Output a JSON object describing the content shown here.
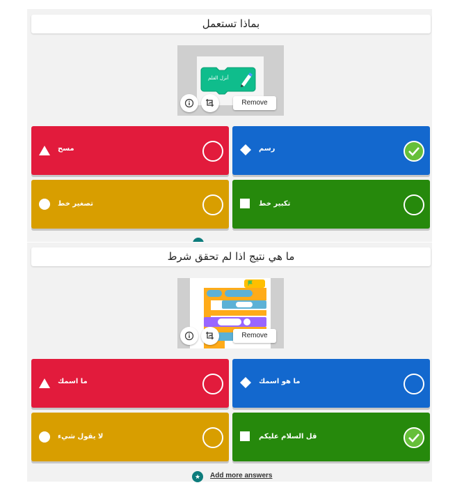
{
  "questions": [
    {
      "title": "بماذا تستعمل",
      "media": {
        "block_label": "أنزل القلم",
        "remove_label": "Remove"
      },
      "options": [
        {
          "text": "مسح",
          "shape": "triangle",
          "color": "red",
          "correct": false
        },
        {
          "text": "رسم",
          "shape": "diamond",
          "color": "blue",
          "correct": true
        },
        {
          "text": "تصغير خط",
          "shape": "circle",
          "color": "yellow",
          "correct": false
        },
        {
          "text": "تكبير خط",
          "shape": "square",
          "color": "green",
          "correct": false
        }
      ]
    },
    {
      "title": "ما هي نتيج  اذا لم تحقق شرط",
      "media": {
        "remove_label": "Remove"
      },
      "options": [
        {
          "text": "ما اسمك",
          "shape": "triangle",
          "color": "red",
          "correct": false
        },
        {
          "text": "ما  هو اسمك",
          "shape": "diamond",
          "color": "blue",
          "correct": false
        },
        {
          "text": "لا يقول شيء",
          "shape": "circle",
          "color": "yellow",
          "correct": false
        },
        {
          "text": "قل السلام عليكم",
          "shape": "square",
          "color": "green",
          "correct": true
        }
      ]
    }
  ],
  "add_more": {
    "label": "Add more answers",
    "icon": "star-icon"
  },
  "colors": {
    "red": "#e21b3c",
    "blue": "#1368ce",
    "yellow": "#d89e00",
    "green": "#26890c",
    "check": "#66bf39",
    "teal": "#0d7c7c"
  }
}
